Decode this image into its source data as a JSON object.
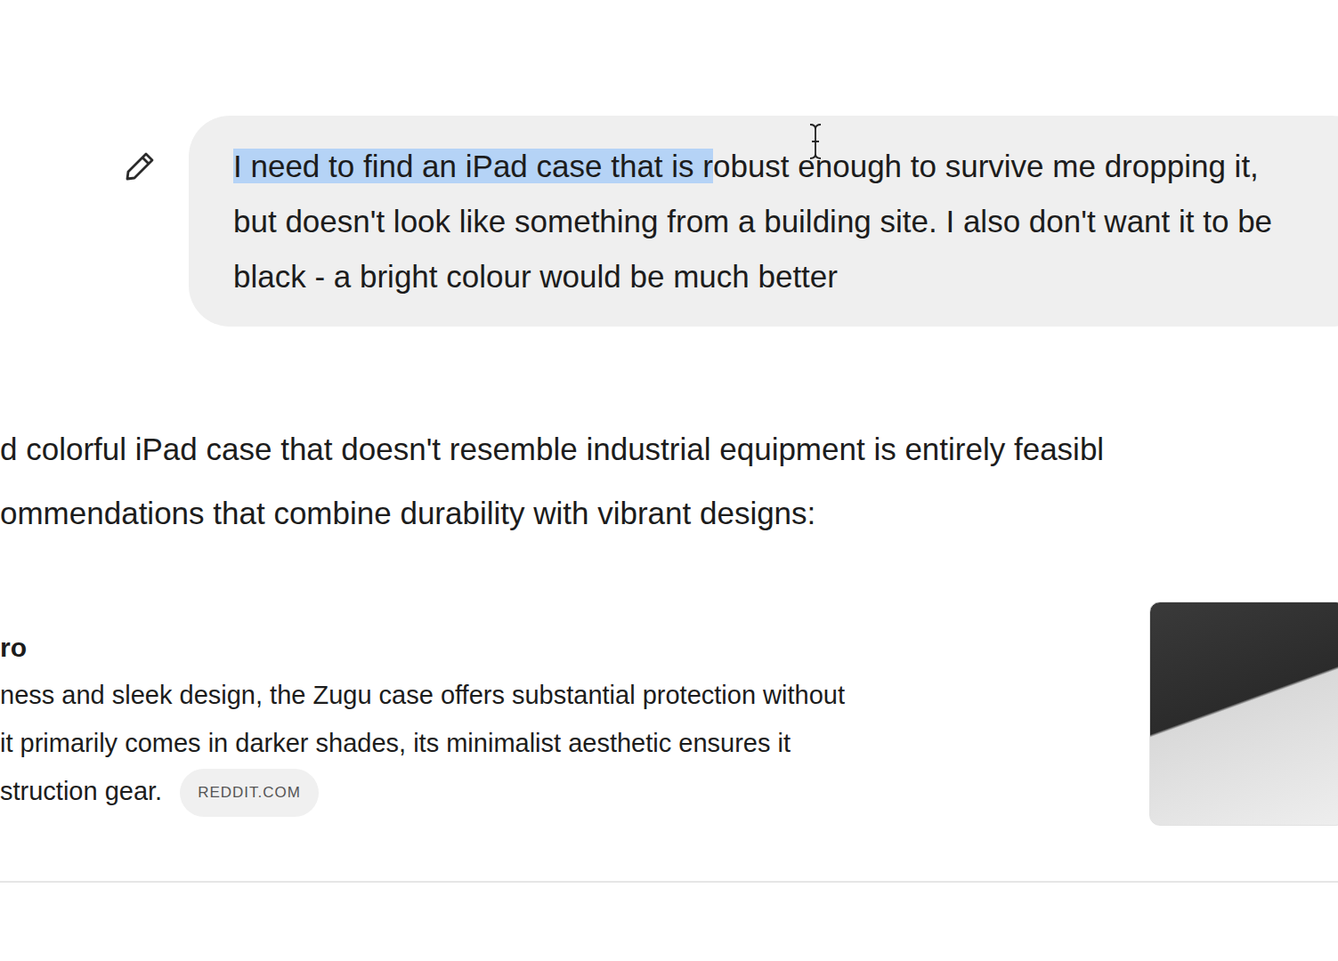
{
  "user_message": {
    "selected_text": "I need to find an iPad case that is r",
    "text": "obust enough to survive me dropping it, but doesn't look like something from a building site. I also don't want it to be black - a bright colour would be much better"
  },
  "response": {
    "intro_lines": [
      "d colorful iPad case that doesn't resemble industrial equipment is entirely feasibl",
      "ommendations that combine durability with vibrant designs:"
    ],
    "items": [
      {
        "title": "ro",
        "lines": [
          "ness and sleek design, the Zugu case offers substantial protection without",
          "it primarily comes in darker shades, its minimalist aesthetic ensures it",
          "struction gear."
        ],
        "source": "REDDIT.COM"
      }
    ]
  }
}
